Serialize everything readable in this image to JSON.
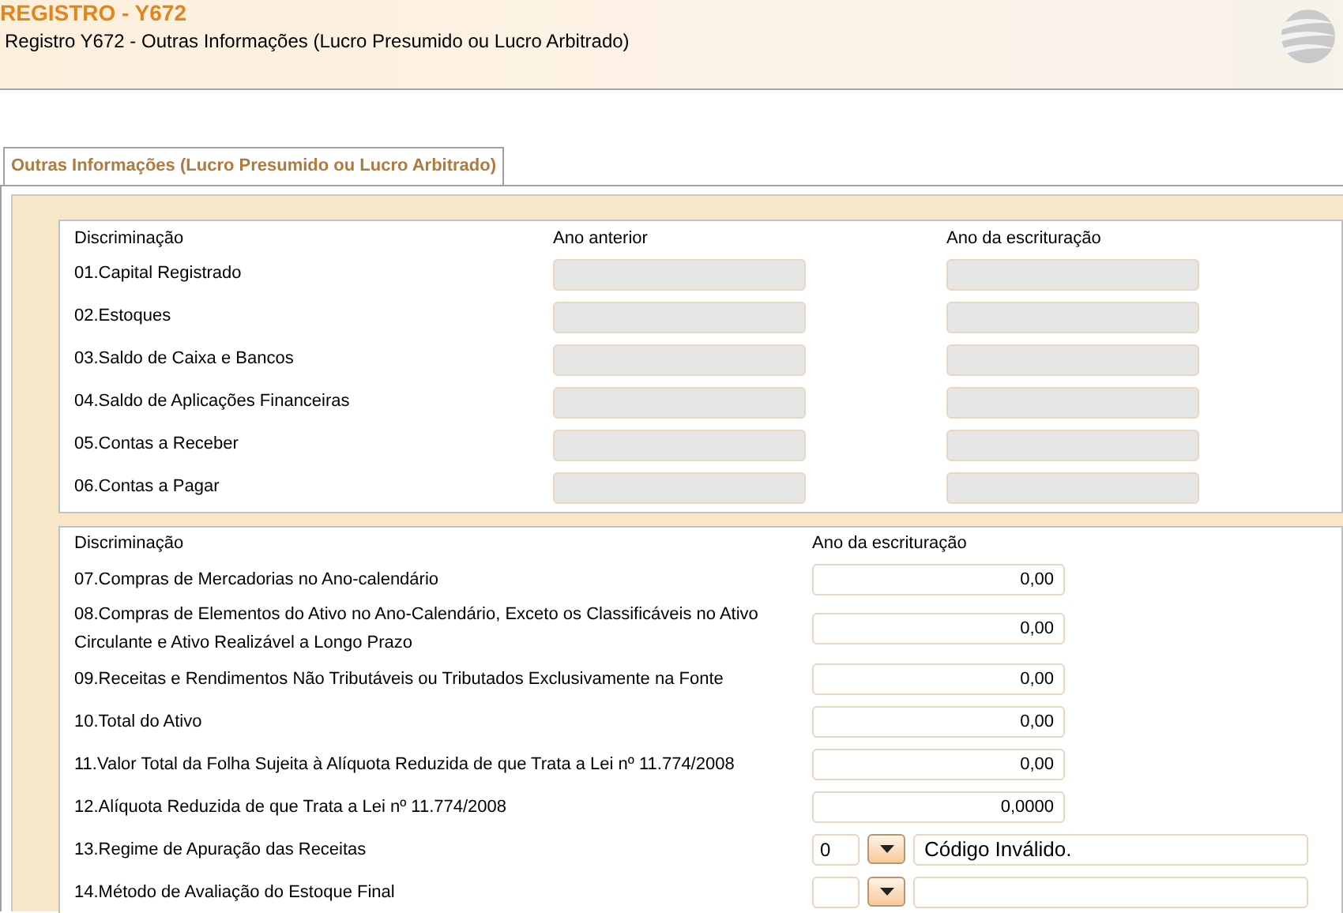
{
  "header": {
    "title": "REGISTRO - Y672",
    "subtitle": "Registro Y672 - Outras Informações (Lucro Presumido ou Lucro Arbitrado)"
  },
  "tabs": [
    {
      "label": "Outras Informações (Lucro Presumido ou Lucro Arbitrado)",
      "selected": true
    }
  ],
  "section_1": {
    "columns": [
      "Discriminação",
      "Ano anterior",
      "Ano da escrituração"
    ],
    "rows": [
      {
        "label": "01.Capital Registrado",
        "disabled": true
      },
      {
        "label": "02.Estoques",
        "disabled": true
      },
      {
        "label": "03.Saldo de Caixa e Bancos",
        "disabled": true
      },
      {
        "label": "04.Saldo de Aplicações Financeiras",
        "disabled": true
      },
      {
        "label": "05.Contas a Receber",
        "disabled": true
      },
      {
        "label": "06.Contas a Pagar",
        "disabled": true
      }
    ]
  },
  "section_2": {
    "columns": [
      "Discriminação",
      "Ano da escrituração"
    ],
    "rows": [
      {
        "kind": "amount",
        "label": "07.Compras de Mercadorias no Ano-calendário",
        "value": "0,00"
      },
      {
        "kind": "amount",
        "label": "08.Compras de Elementos do Ativo no Ano-Calendário, Exceto os Classificáveis no Ativo Circulante e Ativo Realizável a Longo Prazo",
        "value": "0,00"
      },
      {
        "kind": "amount",
        "label": "09.Receitas e Rendimentos Não Tributáveis ou Tributados Exclusivamente na Fonte",
        "value": "0,00"
      },
      {
        "kind": "amount",
        "label": "10.Total do Ativo",
        "value": "0,00"
      },
      {
        "kind": "amount",
        "label": "11.Valor Total da Folha Sujeita à Alíquota Reduzida de que Trata a Lei nº 11.774/2008",
        "value": "0,00"
      },
      {
        "kind": "amount",
        "label": "12.Alíquota Reduzida de que Trata a Lei nº 11.774/2008",
        "value": "0,0000"
      },
      {
        "kind": "select",
        "label": "13.Regime de Apuração das Receitas",
        "code": "0",
        "description": "Código Inválido."
      },
      {
        "kind": "select",
        "label": "14.Método de Avaliação do Estoque Final"
      }
    ]
  }
}
